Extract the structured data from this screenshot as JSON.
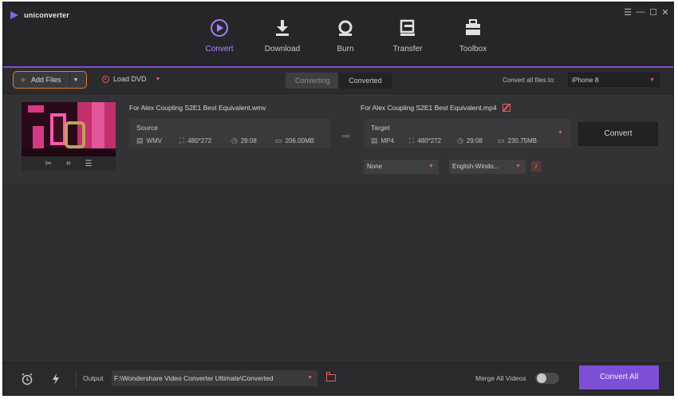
{
  "app": {
    "title": "uniconverter"
  },
  "nav": {
    "tabs": [
      {
        "label": "Convert",
        "icon": "convert-icon",
        "active": true
      },
      {
        "label": "Download",
        "icon": "download-icon",
        "active": false
      },
      {
        "label": "Burn",
        "icon": "burn-icon",
        "active": false
      },
      {
        "label": "Transfer",
        "icon": "transfer-icon",
        "active": false
      },
      {
        "label": "Toolbox",
        "icon": "toolbox-icon",
        "active": false
      }
    ]
  },
  "toolbar": {
    "add_files": "Add Files",
    "load_dvd": "Load DVD",
    "segments": {
      "converting": "Converting",
      "converted": "Converted"
    },
    "convert_all_label": "Convert all files to:",
    "convert_all_value": "iPhone 8"
  },
  "file": {
    "source_name": "For Alex Coupling S2E1 Best Equivalent.wmv",
    "target_name": "For Alex Coupling S2E1 Best Equivalent.mp4",
    "source": {
      "title": "Source",
      "format": "WMV",
      "resolution": "480*272",
      "duration": "29:08",
      "size": "206.00MB"
    },
    "target": {
      "title": "Target",
      "format": "MP4",
      "resolution": "480*272",
      "duration": "29:08",
      "size": "230.75MB"
    },
    "convert_button": "Convert",
    "subtitle": "None",
    "audio": "English-Windo..."
  },
  "bottom": {
    "output_label": "Output",
    "output_path": "F:\\Wondershare Video Converter Ultimate\\Converted",
    "merge_label": "Merge All Videos",
    "merge_on": false,
    "convert_all_button": "Convert All"
  },
  "colors": {
    "accent": "#7d4fd6",
    "highlight": "#e07b2f",
    "icon_red": "#e0605a"
  }
}
